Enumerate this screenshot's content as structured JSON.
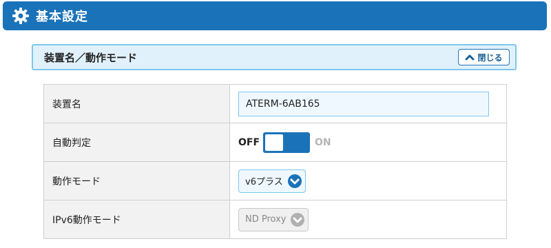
{
  "header": {
    "title": "基本設定",
    "icon": "gear-icon"
  },
  "section": {
    "title": "装置名／動作モード",
    "close_label": "閉じる"
  },
  "rows": [
    {
      "label": "装置名",
      "input_value": "ATERM-6AB165"
    },
    {
      "label": "自動判定",
      "toggle_off": "OFF",
      "toggle_on": "ON",
      "toggle_state": "OFF"
    },
    {
      "label": "動作モード",
      "select_value": "v6プラス"
    },
    {
      "label": "IPv6動作モード",
      "select_value": "ND Proxy",
      "disabled": true
    }
  ],
  "colors": {
    "brand": "#1a73b8",
    "section_bg": "#e1f1fb",
    "section_border": "#7ec6ea"
  }
}
